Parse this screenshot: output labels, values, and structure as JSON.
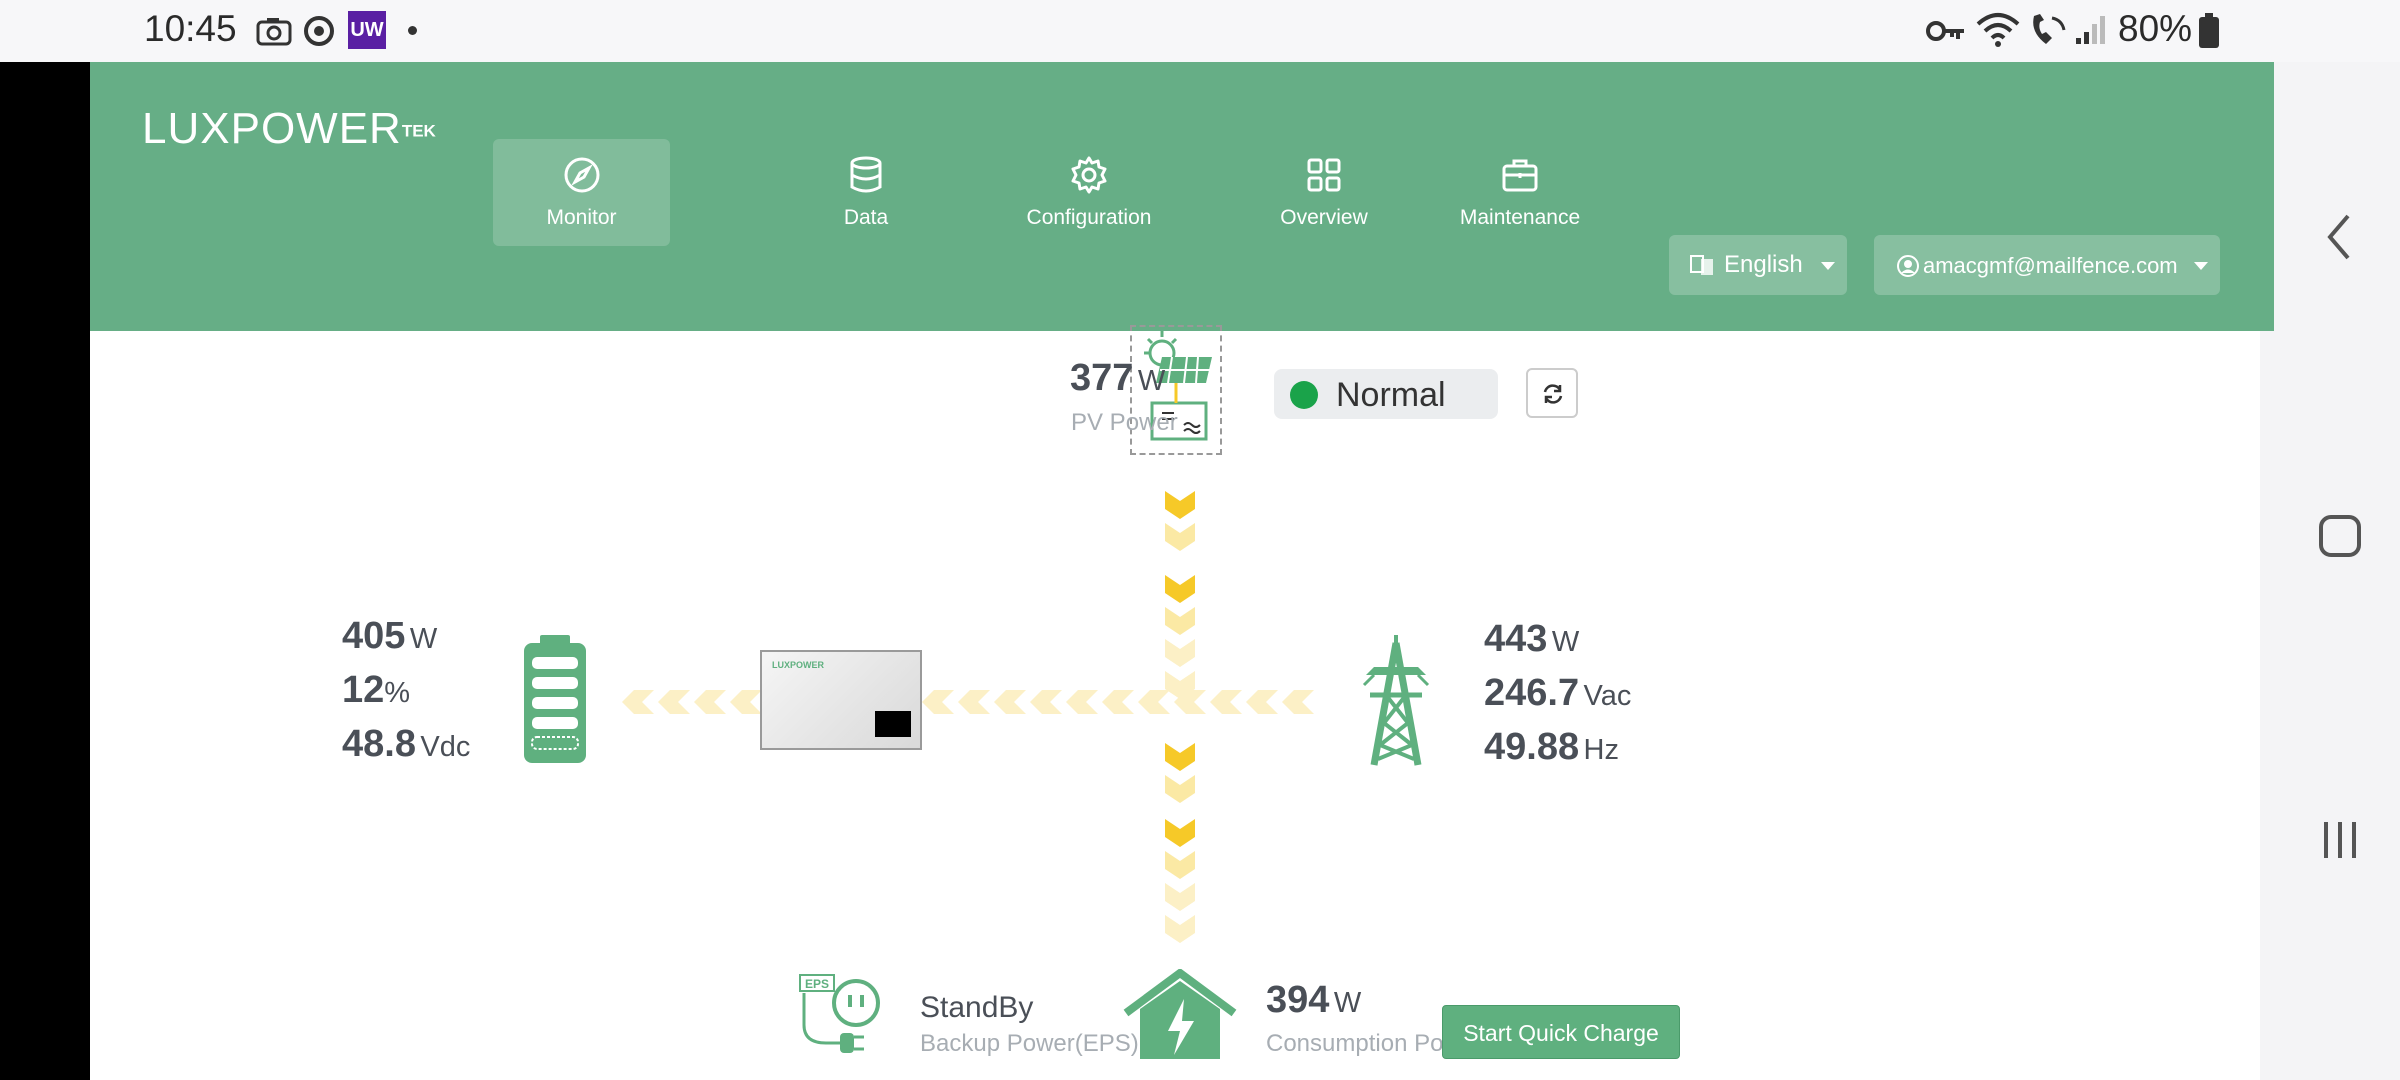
{
  "status_bar": {
    "time": "10:45",
    "app_badge": "UW",
    "battery": "80%"
  },
  "header": {
    "logo": "LUXPOWER",
    "logo_suffix": "TEK",
    "nav": [
      {
        "label": "Monitor",
        "icon": "compass-icon",
        "active": true
      },
      {
        "label": "Data",
        "icon": "database-icon"
      },
      {
        "label": "Configuration",
        "icon": "gear-icon"
      },
      {
        "label": "Overview",
        "icon": "grid-icon"
      },
      {
        "label": "Maintenance",
        "icon": "briefcase-icon"
      }
    ],
    "language": "English",
    "user": "amacgmf@mailfence.com"
  },
  "monitor": {
    "pv": {
      "value": "377",
      "unit": "W",
      "label": "PV Power"
    },
    "status": "Normal",
    "status_color": "#1aa34a",
    "battery": {
      "power": "405",
      "power_unit": "W",
      "soc": "12",
      "soc_unit": "%",
      "voltage": "48.8",
      "voltage_unit": "Vdc"
    },
    "grid": {
      "power": "443",
      "power_unit": "W",
      "voltage": "246.7",
      "voltage_unit": "Vac",
      "frequency": "49.88",
      "frequency_unit": "Hz"
    },
    "eps": {
      "state": "StandBy",
      "label": "Backup Power(EPS)",
      "badge": "EPS"
    },
    "consumption": {
      "value": "394",
      "unit": "W",
      "label": "Consumption Po"
    },
    "quick_charge_button": "Start Quick Charge",
    "accent_green": "#5fb07f",
    "flow_yellow": "#f6c928"
  }
}
